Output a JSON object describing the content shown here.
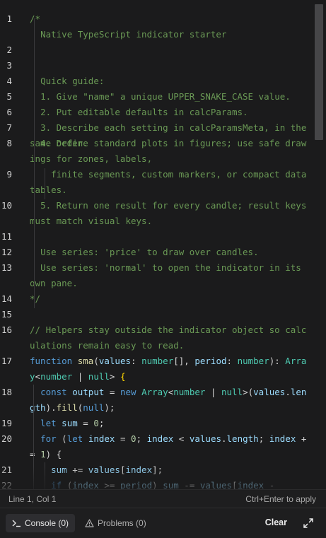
{
  "editor": {
    "lines": [
      {
        "num": "1",
        "tokens": [
          {
            "t": "c",
            "v": "/*"
          }
        ]
      },
      {
        "num": "",
        "tokens": [
          {
            "t": "c",
            "v": "  Native TypeScript indicator starter"
          }
        ]
      },
      {
        "num": "2",
        "tokens": []
      },
      {
        "num": "3",
        "tokens": []
      },
      {
        "num": "4",
        "tokens": [
          {
            "t": "c",
            "v": "  Quick guide:"
          }
        ]
      },
      {
        "num": "5",
        "tokens": [
          {
            "t": "c",
            "v": "  1. Give \"name\" a unique UPPER_SNAKE_CASE value."
          }
        ]
      },
      {
        "num": "6",
        "tokens": [
          {
            "t": "c",
            "v": "  2. Put editable defaults in calcParams."
          }
        ]
      },
      {
        "num": "7",
        "tokens": [
          {
            "t": "c",
            "v": "  3. Describe each setting in calcParamsMeta, in the same order."
          }
        ]
      },
      {
        "num": "8",
        "tokens": [
          {
            "t": "c",
            "v": "  4. Define standard plots in figures; use safe drawings for zones, labels,"
          }
        ]
      },
      {
        "num": "9",
        "tokens": [
          {
            "t": "c",
            "v": "    finite segments, custom markers, or compact data tables."
          }
        ]
      },
      {
        "num": "10",
        "tokens": [
          {
            "t": "c",
            "v": "  5. Return one result for every candle; result keys must match visual keys."
          }
        ]
      },
      {
        "num": "11",
        "tokens": []
      },
      {
        "num": "12",
        "tokens": [
          {
            "t": "c",
            "v": "  Use series: 'price' to draw over candles."
          }
        ]
      },
      {
        "num": "13",
        "tokens": [
          {
            "t": "c",
            "v": "  Use series: 'normal' to open the indicator in its own pane."
          }
        ]
      },
      {
        "num": "14",
        "tokens": [
          {
            "t": "c",
            "v": "*/"
          }
        ]
      },
      {
        "num": "15",
        "tokens": []
      },
      {
        "num": "16",
        "tokens": [
          {
            "t": "c",
            "v": "// Helpers stay outside the indicator object so calculations remain easy to read."
          }
        ]
      },
      {
        "num": "17",
        "tokens": [
          {
            "t": "k",
            "v": "function"
          },
          {
            "t": "p",
            "v": " "
          },
          {
            "t": "f",
            "v": "sma"
          },
          {
            "t": "p",
            "v": "("
          },
          {
            "t": "v",
            "v": "values"
          },
          {
            "t": "p",
            "v": ": "
          },
          {
            "t": "t",
            "v": "number"
          },
          {
            "t": "p",
            "v": "[], "
          },
          {
            "t": "v",
            "v": "period"
          },
          {
            "t": "p",
            "v": ": "
          },
          {
            "t": "t",
            "v": "number"
          },
          {
            "t": "p",
            "v": "): "
          },
          {
            "t": "t",
            "v": "Array"
          },
          {
            "t": "p",
            "v": "<"
          },
          {
            "t": "t",
            "v": "number"
          },
          {
            "t": "p",
            "v": " | "
          },
          {
            "t": "t",
            "v": "null"
          },
          {
            "t": "p",
            "v": "> "
          },
          {
            "t": "b",
            "v": "{"
          }
        ]
      },
      {
        "num": "18",
        "tokens": [
          {
            "t": "p",
            "v": "  "
          },
          {
            "t": "k",
            "v": "const"
          },
          {
            "t": "p",
            "v": " "
          },
          {
            "t": "v",
            "v": "output"
          },
          {
            "t": "p",
            "v": " = "
          },
          {
            "t": "k",
            "v": "new"
          },
          {
            "t": "p",
            "v": " "
          },
          {
            "t": "t",
            "v": "Array"
          },
          {
            "t": "p",
            "v": "<"
          },
          {
            "t": "t",
            "v": "number"
          },
          {
            "t": "p",
            "v": " | "
          },
          {
            "t": "t",
            "v": "null"
          },
          {
            "t": "p",
            "v": ">("
          },
          {
            "t": "v",
            "v": "values"
          },
          {
            "t": "p",
            "v": "."
          },
          {
            "t": "v",
            "v": "length"
          },
          {
            "t": "p",
            "v": ")."
          },
          {
            "t": "f",
            "v": "fill"
          },
          {
            "t": "p",
            "v": "("
          },
          {
            "t": "k",
            "v": "null"
          },
          {
            "t": "p",
            "v": ");"
          }
        ]
      },
      {
        "num": "19",
        "tokens": [
          {
            "t": "p",
            "v": "  "
          },
          {
            "t": "k",
            "v": "let"
          },
          {
            "t": "p",
            "v": " "
          },
          {
            "t": "v",
            "v": "sum"
          },
          {
            "t": "p",
            "v": " = "
          },
          {
            "t": "n",
            "v": "0"
          },
          {
            "t": "p",
            "v": ";"
          }
        ]
      },
      {
        "num": "20",
        "tokens": [
          {
            "t": "p",
            "v": "  "
          },
          {
            "t": "k",
            "v": "for"
          },
          {
            "t": "p",
            "v": " ("
          },
          {
            "t": "k",
            "v": "let"
          },
          {
            "t": "p",
            "v": " "
          },
          {
            "t": "v",
            "v": "index"
          },
          {
            "t": "p",
            "v": " = "
          },
          {
            "t": "n",
            "v": "0"
          },
          {
            "t": "p",
            "v": "; "
          },
          {
            "t": "v",
            "v": "index"
          },
          {
            "t": "p",
            "v": " < "
          },
          {
            "t": "v",
            "v": "values"
          },
          {
            "t": "p",
            "v": "."
          },
          {
            "t": "v",
            "v": "length"
          },
          {
            "t": "p",
            "v": "; "
          },
          {
            "t": "v",
            "v": "index"
          },
          {
            "t": "p",
            "v": " += "
          },
          {
            "t": "n",
            "v": "1"
          },
          {
            "t": "p",
            "v": ") {"
          }
        ]
      },
      {
        "num": "21",
        "tokens": [
          {
            "t": "p",
            "v": "    "
          },
          {
            "t": "v",
            "v": "sum"
          },
          {
            "t": "p",
            "v": " += "
          },
          {
            "t": "v",
            "v": "values"
          },
          {
            "t": "p",
            "v": "["
          },
          {
            "t": "v",
            "v": "index"
          },
          {
            "t": "p",
            "v": "];"
          }
        ]
      },
      {
        "num": "22",
        "tokens": [
          {
            "t": "p",
            "v": "    "
          },
          {
            "t": "k",
            "v": "if"
          },
          {
            "t": "p",
            "v": " ("
          },
          {
            "t": "v",
            "v": "index"
          },
          {
            "t": "p",
            "v": " >= "
          },
          {
            "t": "v",
            "v": "period"
          },
          {
            "t": "p",
            "v": ") "
          },
          {
            "t": "v",
            "v": "sum"
          },
          {
            "t": "p",
            "v": " -= "
          },
          {
            "t": "v",
            "v": "values"
          },
          {
            "t": "p",
            "v": "["
          },
          {
            "t": "v",
            "v": "index"
          },
          {
            "t": "p",
            "v": " -"
          }
        ]
      }
    ]
  },
  "status_bar": {
    "position": "Line 1, Col 1",
    "hint": "Ctrl+Enter to apply"
  },
  "bottom_bar": {
    "console_label": "Console (0)",
    "problems_label": "Problems (0)",
    "clear_label": "Clear"
  },
  "colors": {
    "background": "#1b1b1c",
    "comment": "#6a9955",
    "keyword": "#569cd6",
    "type": "#4ec9b0",
    "function": "#dcdcaa",
    "variable": "#9cdcfe",
    "number": "#b5cea8"
  },
  "icons": {
    "console": "terminal-icon",
    "problems": "warning-triangle-icon",
    "expand": "expand-icon"
  }
}
